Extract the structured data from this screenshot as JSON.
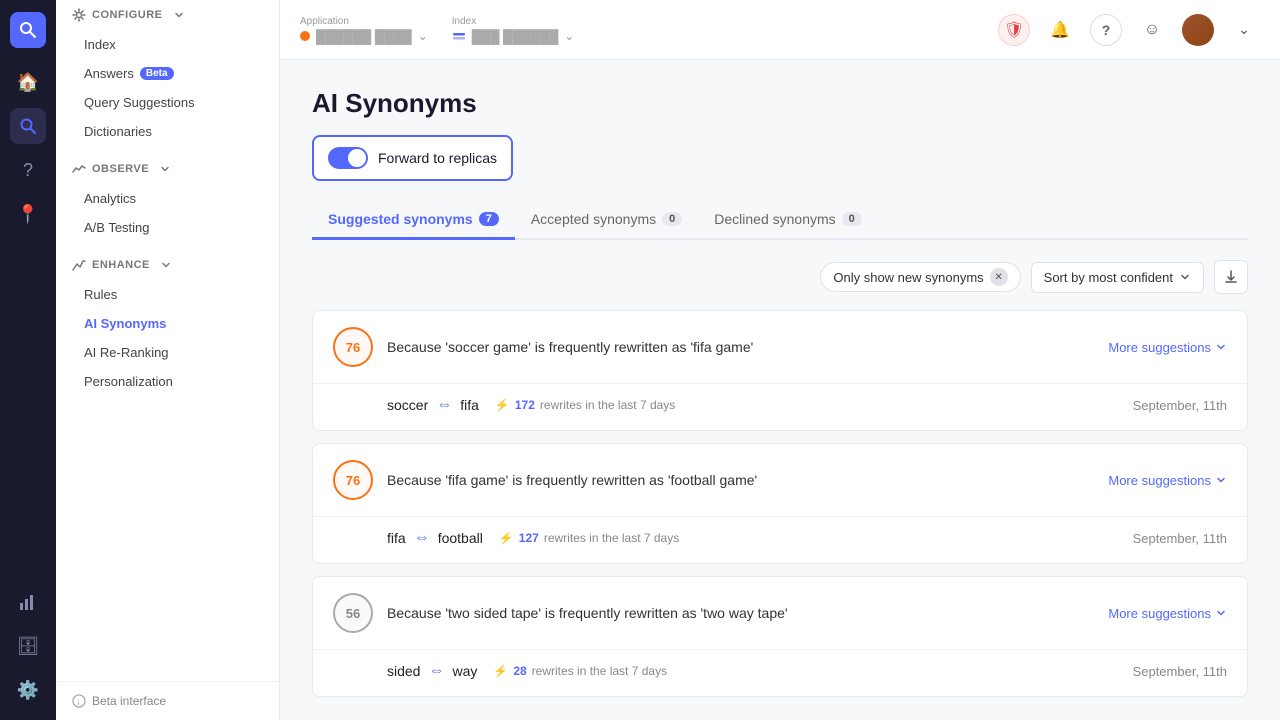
{
  "app": {
    "name": "SEARCH",
    "application_label": "Application",
    "index_label": "Index",
    "app_name_placeholder": "ello base",
    "index_name_placeholder": "ello gar-eel"
  },
  "topbar_icons": {
    "shield": "🛡",
    "bell": "🔔",
    "question": "?",
    "smiley": "☺"
  },
  "sidebar": {
    "configure_label": "CONFIGURE",
    "observe_label": "OBSERVE",
    "enhance_label": "ENHANCE",
    "configure_items": [
      {
        "label": "Index",
        "active": false
      },
      {
        "label": "Answers",
        "badge": "Beta",
        "active": false
      },
      {
        "label": "Query Suggestions",
        "active": false
      },
      {
        "label": "Dictionaries",
        "active": false
      }
    ],
    "observe_items": [
      {
        "label": "Analytics",
        "active": false
      },
      {
        "label": "A/B Testing",
        "active": false
      }
    ],
    "enhance_items": [
      {
        "label": "Rules",
        "active": false
      },
      {
        "label": "AI Synonyms",
        "active": true
      },
      {
        "label": "AI Re-Ranking",
        "active": false
      },
      {
        "label": "Personalization",
        "active": false
      }
    ],
    "footer_label": "Beta interface"
  },
  "page": {
    "title": "AI Synonyms",
    "forward_toggle_label": "Forward to replicas",
    "toggle_on": true
  },
  "tabs": [
    {
      "label": "Suggested synonyms",
      "count": "7",
      "active": true
    },
    {
      "label": "Accepted synonyms",
      "count": "0",
      "active": false
    },
    {
      "label": "Declined synonyms",
      "count": "0",
      "active": false
    }
  ],
  "filters": {
    "only_new_label": "Only show new synonyms",
    "sort_label": "Sort by most confident"
  },
  "cards": [
    {
      "score": "76",
      "score_type": "orange",
      "reason": "Because 'soccer game' is frequently rewritten as 'fifa game'",
      "more_suggestions": "More suggestions",
      "word1": "soccer",
      "word2": "fifa",
      "rewrites_count": "172",
      "rewrites_label": "rewrites in the last 7 days",
      "date": "September, 11th"
    },
    {
      "score": "76",
      "score_type": "orange",
      "reason": "Because 'fifa game' is frequently rewritten as 'football game'",
      "more_suggestions": "More suggestions",
      "word1": "fifa",
      "word2": "football",
      "rewrites_count": "127",
      "rewrites_label": "rewrites in the last 7 days",
      "date": "September, 11th"
    },
    {
      "score": "56",
      "score_type": "muted",
      "reason": "Because 'two sided tape' is frequently rewritten as 'two way tape'",
      "more_suggestions": "More suggestions",
      "word1": "sided",
      "word2": "way",
      "rewrites_count": "28",
      "rewrites_label": "rewrites in the last 7 days",
      "date": "September, 11th"
    }
  ]
}
